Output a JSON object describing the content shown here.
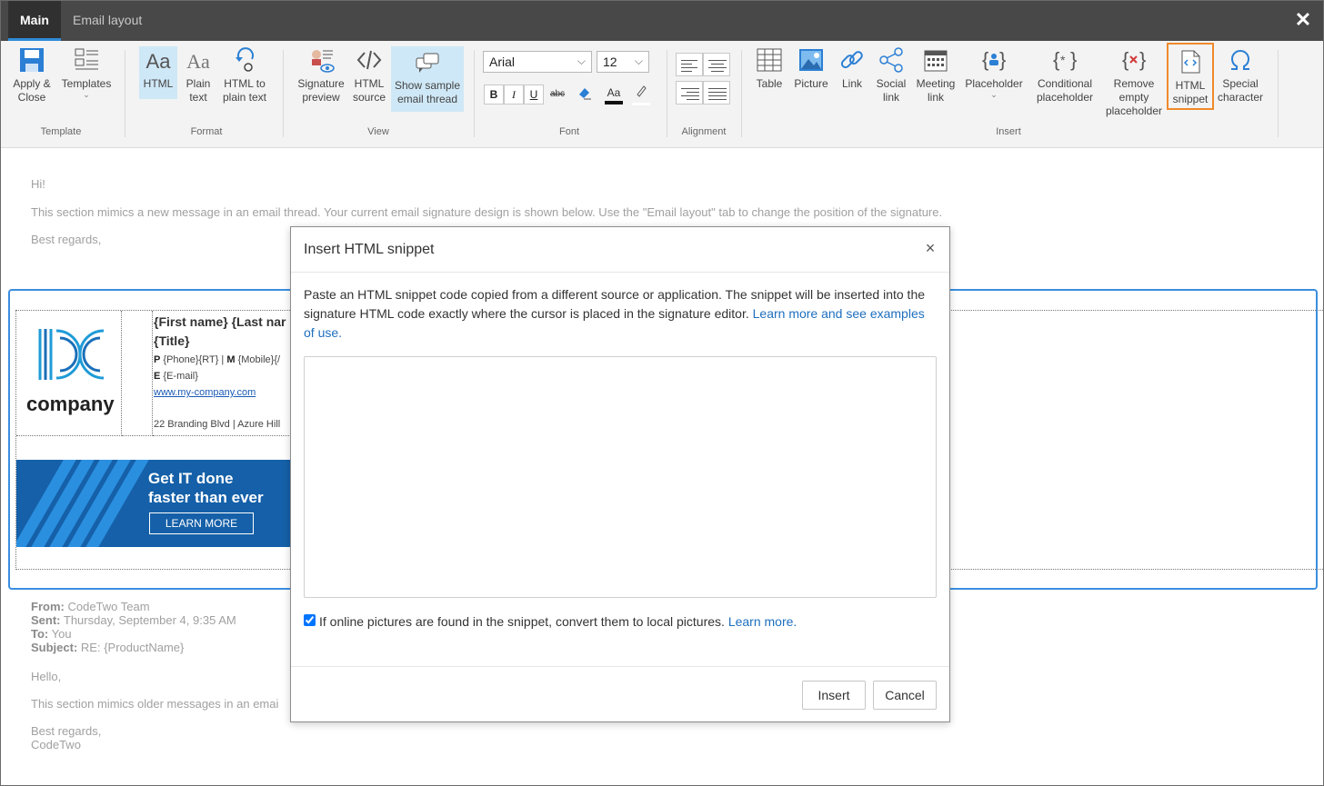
{
  "tabs": [
    {
      "label": "Main"
    },
    {
      "label": "Email layout"
    }
  ],
  "window": {
    "close_glyph": "✕"
  },
  "ribbon": {
    "template": {
      "apply_close": "Apply &\nClose",
      "templates": "Templates",
      "group": "Template"
    },
    "format": {
      "html": "HTML",
      "plain_text": "Plain\ntext",
      "html_to_plain": "HTML to\nplain text",
      "group": "Format"
    },
    "view": {
      "signature_preview": "Signature\npreview",
      "html_source": "HTML\nsource",
      "show_thread": "Show sample\nemail thread",
      "group": "View"
    },
    "font": {
      "family": "Arial",
      "size": "12",
      "bold": "B",
      "italic": "I",
      "underline": "U",
      "strike": "abc",
      "font_color": "Aa",
      "group": "Font"
    },
    "alignment": {
      "group": "Alignment"
    },
    "insert": {
      "table": "Table",
      "picture": "Picture",
      "link": "Link",
      "social_link": "Social\nlink",
      "meeting_link": "Meeting\nlink",
      "placeholder": "Placeholder",
      "conditional": "Conditional\nplaceholder",
      "remove_empty": "Remove\nempty\nplaceholder",
      "html_snippet": "HTML\nsnippet",
      "special_char": "Special\ncharacter",
      "group": "Insert"
    }
  },
  "editor": {
    "greeting": "Hi!",
    "intro": "This section mimics a new message in an email thread. Your current email signature design is shown below. Use the \"Email layout\" tab to change the position of the signature.",
    "regards": "Best regards,",
    "signature": {
      "logo_text": "company",
      "name": "{First name} {Last nar",
      "title": "{Title}",
      "phone_p": "P",
      "phone": "{Phone}{RT} | ",
      "mobile_m": "M",
      "mobile": "{Mobile}{/",
      "email_e": "E",
      "email": "{E-mail}",
      "website": "www.my-company.com",
      "address": "22 Branding Blvd | Azure Hill",
      "banner_line1": "Get IT done",
      "banner_line2": "faster than ever",
      "banner_button": "LEARN MORE"
    },
    "thread": {
      "from_label": "From:",
      "from": "CodeTwo Team",
      "sent_label": "Sent:",
      "sent": "Thursday, September 4, 9:35 AM",
      "to_label": "To:",
      "to": "You",
      "subject_label": "Subject:",
      "subject": "RE: {ProductName}",
      "hello": "Hello,",
      "older": "This section mimics older messages in an emai",
      "regards": "Best regards,",
      "sender": "CodeTwo"
    }
  },
  "modal": {
    "title": "Insert HTML snippet",
    "close_glyph": "×",
    "description": "Paste an HTML snippet code copied from a different source or application. The snippet will be inserted into the signature HTML code exactly where the cursor is placed in the signature editor. ",
    "learn_more_examples": "Learn more and see examples of use.",
    "snippet_value": "",
    "convert_checked": true,
    "convert_label": "If online pictures are found in the snippet, convert them to local pictures. ",
    "learn_more": "Learn more.",
    "insert": "Insert",
    "cancel": "Cancel"
  },
  "colors": {
    "accent": "#2f8bd8",
    "highlight": "#ef8a2c",
    "banner": "#1560a8",
    "link": "#1e6fbf"
  }
}
